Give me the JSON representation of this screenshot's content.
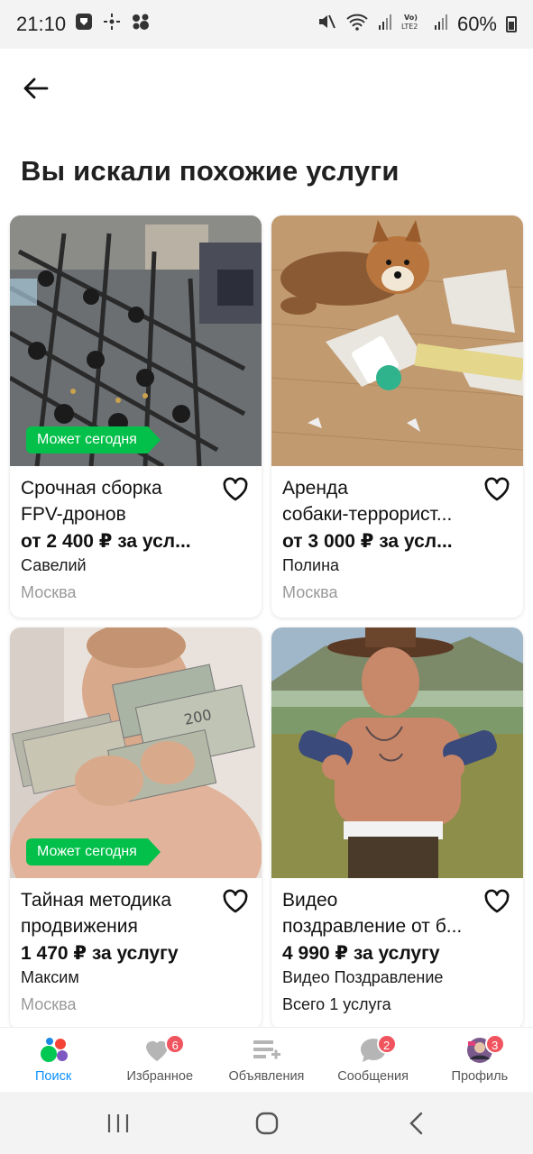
{
  "status_bar": {
    "time": "21:10",
    "battery": "60%"
  },
  "page": {
    "title": "Вы искали похожие услуги"
  },
  "listings": [
    {
      "title_line1": "Срочная сборка",
      "title_line2": "FPV-дронов",
      "price": "от 2 400 ₽ за усл...",
      "seller": "Савелий",
      "city": "Москва",
      "badge": "Может сегодня",
      "image": "drone-frames-photo"
    },
    {
      "title_line1": "Аренда",
      "title_line2": "собаки-террорист...",
      "price": "от 3 000 ₽ за усл...",
      "seller": "Полина",
      "city": "Москва",
      "badge": "",
      "image": "shiba-dog-photo"
    },
    {
      "title_line1": "Тайная методика",
      "title_line2": "продвижения",
      "price": "1 470 ₽ за услугу",
      "seller": "Максим",
      "city": "Москва",
      "badge": "Может сегодня",
      "image": "child-with-money-photo"
    },
    {
      "title_line1": "Видео",
      "title_line2": "поздравление от б...",
      "price": "4 990 ₽ за услугу",
      "seller": "Видео Поздравление",
      "extra": "Всего 1 услуга",
      "badge": "",
      "image": "cowboy-man-photo"
    }
  ],
  "bottom_nav": [
    {
      "label": "Поиск",
      "icon": "search-dots-icon",
      "active": true
    },
    {
      "label": "Избранное",
      "icon": "heart-icon",
      "badge": "6"
    },
    {
      "label": "Объявления",
      "icon": "listings-add-icon"
    },
    {
      "label": "Сообщения",
      "icon": "chat-bubble-icon",
      "badge": "2"
    },
    {
      "label": "Профиль",
      "icon": "profile-avatar-icon",
      "badge": "3"
    }
  ],
  "colors": {
    "accent": "#0a90ff",
    "badge_green": "#02c04a",
    "count_badge": "#f0545e"
  }
}
